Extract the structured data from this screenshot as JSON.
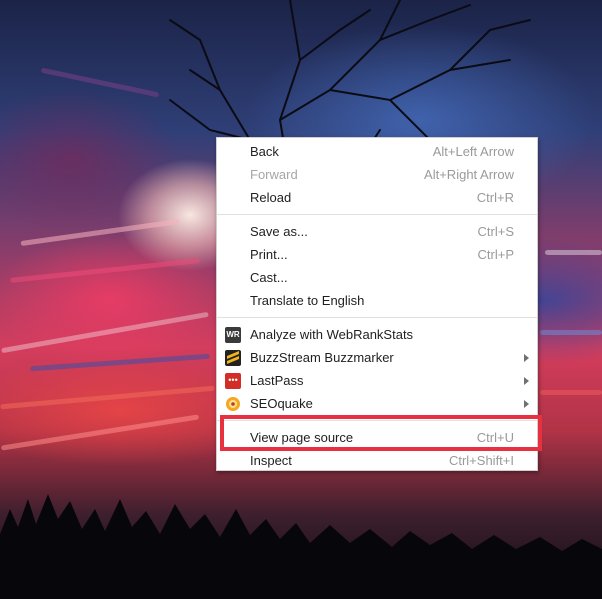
{
  "menu": {
    "items": [
      {
        "label": "Back",
        "shortcut": "Alt+Left Arrow"
      },
      {
        "label": "Forward",
        "shortcut": "Alt+Right Arrow"
      },
      {
        "label": "Reload",
        "shortcut": "Ctrl+R"
      },
      {
        "label": "Save as...",
        "shortcut": "Ctrl+S"
      },
      {
        "label": "Print...",
        "shortcut": "Ctrl+P"
      },
      {
        "label": "Cast...",
        "shortcut": ""
      },
      {
        "label": "Translate to English",
        "shortcut": ""
      },
      {
        "label": "Analyze with WebRankStats",
        "shortcut": ""
      },
      {
        "label": "BuzzStream Buzzmarker",
        "shortcut": ""
      },
      {
        "label": "LastPass",
        "shortcut": ""
      },
      {
        "label": "SEOquake",
        "shortcut": ""
      },
      {
        "label": "View page source",
        "shortcut": "Ctrl+U"
      },
      {
        "label": "Inspect",
        "shortcut": "Ctrl+Shift+I"
      }
    ],
    "icons": {
      "webrankstats": "WR",
      "buzzstream": "buzzstream-icon",
      "lastpass": "•••",
      "seoquake": "SQ"
    }
  },
  "colors": {
    "highlight": "#e8313e",
    "menu_bg": "#ffffff",
    "disabled_text": "#a6a6a6",
    "shortcut_text": "#9a9a9a"
  }
}
